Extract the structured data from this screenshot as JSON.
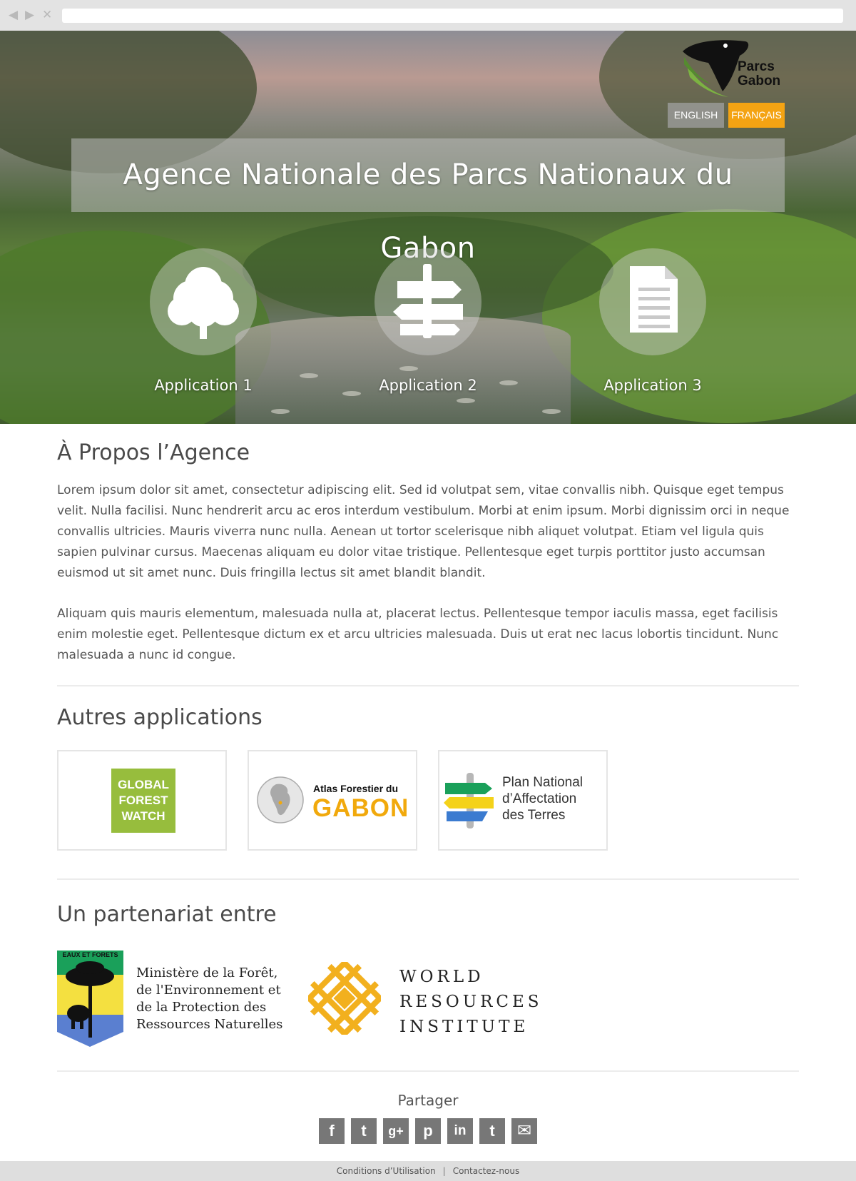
{
  "browser": {
    "back": "◀",
    "forward": "▶",
    "close": "✕"
  },
  "header": {
    "logo_line1": "Parcs",
    "logo_line2": "Gabon",
    "lang_english": "ENGLISH",
    "lang_french": "FRANÇAIS",
    "title": "Agence Nationale des Parcs Nationaux du Gabon"
  },
  "apps": [
    {
      "label": "Application 1",
      "icon": "tree-icon"
    },
    {
      "label": "Application 2",
      "icon": "signpost-icon"
    },
    {
      "label": "Application 3",
      "icon": "document-icon"
    }
  ],
  "about": {
    "heading": "À Propos l’Agence",
    "paragraph1": "Lorem ipsum dolor sit amet, consectetur adipiscing elit. Sed id volutpat sem, vitae convallis nibh. Quisque eget tempus velit. Nulla facilisi. Nunc hendrerit arcu ac eros interdum vestibulum. Morbi at enim ipsum. Morbi dignissim orci in neque convallis ultricies. Mauris viverra nunc nulla. Aenean ut tortor scelerisque nibh aliquet volutpat. Etiam vel ligula quis sapien pulvinar cursus. Maecenas aliquam eu dolor vitae tristique. Pellentesque eget turpis porttitor justo accumsan euismod ut sit amet nunc. Duis fringilla lectus sit amet blandit blandit.",
    "paragraph2": "Aliquam quis mauris elementum, malesuada nulla at, placerat lectus. Pellentesque tempor iaculis massa, eget facilisis enim molestie eget. Pellentesque dictum ex et arcu ultricies malesuada. Duis ut erat nec lacus lobortis tincidunt. Nunc malesuada a nunc id congue."
  },
  "other_apps": {
    "heading": "Autres applications",
    "gfw": {
      "line1": "GLOBAL",
      "line2": "FOREST",
      "line3": "WATCH",
      "color": "#97bd3d"
    },
    "atlas": {
      "line1": "Atlas Forestier du",
      "line2": "GABON",
      "color": "#f1a90c"
    },
    "pnat": {
      "line1": "Plan National",
      "line2": "d’Affectation",
      "line3": "des Terres"
    }
  },
  "partners": {
    "heading": "Un partenariat entre",
    "ministry_badge": "EAUX ET FORETS",
    "ministry_line1": "Ministère de la Forêt,",
    "ministry_line2": "de l'Environnement et",
    "ministry_line3": "de la Protection des",
    "ministry_line4": "Ressources Naturelles",
    "wri_line1": "WORLD",
    "wri_line2": "RESOURCES",
    "wri_line3": "INSTITUTE",
    "wri_color": "#f2b01e"
  },
  "share": {
    "label": "Partager",
    "buttons": [
      {
        "glyph": "f",
        "icon": "facebook-icon"
      },
      {
        "glyph": "t",
        "icon": "twitter-icon"
      },
      {
        "glyph": "g+",
        "icon": "google-plus-icon"
      },
      {
        "glyph": "p",
        "icon": "pinterest-icon"
      },
      {
        "glyph": "in",
        "icon": "linkedin-icon"
      },
      {
        "glyph": "t",
        "icon": "tumblr-icon"
      },
      {
        "glyph": "✉",
        "icon": "email-icon"
      }
    ]
  },
  "footer": {
    "terms": "Conditions d’Utilisation",
    "separator": "|",
    "contact": "Contactez-nous"
  }
}
